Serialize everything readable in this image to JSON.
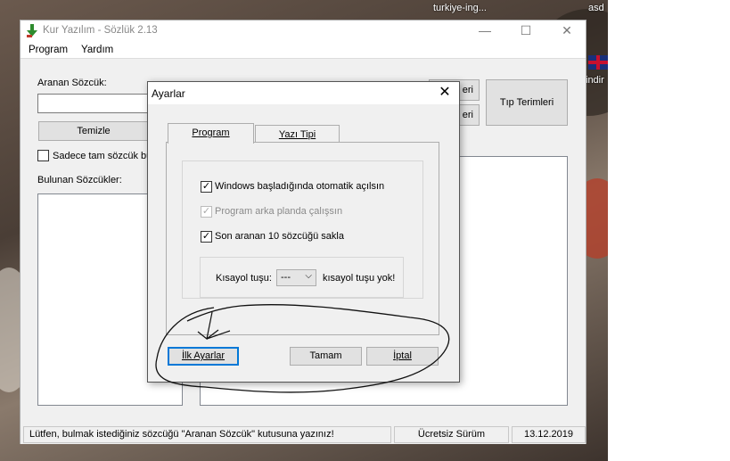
{
  "desktop": {
    "top_label": "turkiye-ing...",
    "right_label": "asd",
    "side_label": "indir"
  },
  "app": {
    "title": "Kur Yazılım - Sözlük 2.13",
    "menu": [
      "Program",
      "Yardım"
    ],
    "search_label": "Aranan Sözcük:",
    "search_value": "",
    "clear_button": "Temizle",
    "exact_match_label": "Sadece tam sözcük bul",
    "found_label": "Bulunan Sözcükler:",
    "partial_buttons": [
      "eri",
      "eri"
    ],
    "medical_terms_button": "Tıp Terimleri",
    "status": {
      "message": "Lütfen, bulmak istediğiniz sözcüğü \"Aranan Sözcük\" kutusuna yazınız!",
      "edition": "Ücretsiz Sürüm",
      "date": "13.12.2019"
    }
  },
  "dialog": {
    "title": "Ayarlar",
    "close_glyph": "✕",
    "tabs": [
      "Program",
      "Yazı Tipi"
    ],
    "options": [
      {
        "label": "Windows başladığında otomatik açılsın",
        "checked": true,
        "enabled": true
      },
      {
        "label": "Program arka planda çalışsın",
        "checked": true,
        "enabled": false
      },
      {
        "label": "Son aranan 10 sözcüğü sakla",
        "checked": true,
        "enabled": true
      }
    ],
    "hotkey_label": "Kısayol tuşu:",
    "hotkey_value": "---",
    "hotkey_note": "kısayol tuşu yok!",
    "buttons": {
      "defaults": "İlk Ayarlar",
      "ok": "Tamam",
      "cancel": "İptal"
    }
  },
  "colors": {
    "focus_border": "#0078d7",
    "scribble": "#111111"
  }
}
